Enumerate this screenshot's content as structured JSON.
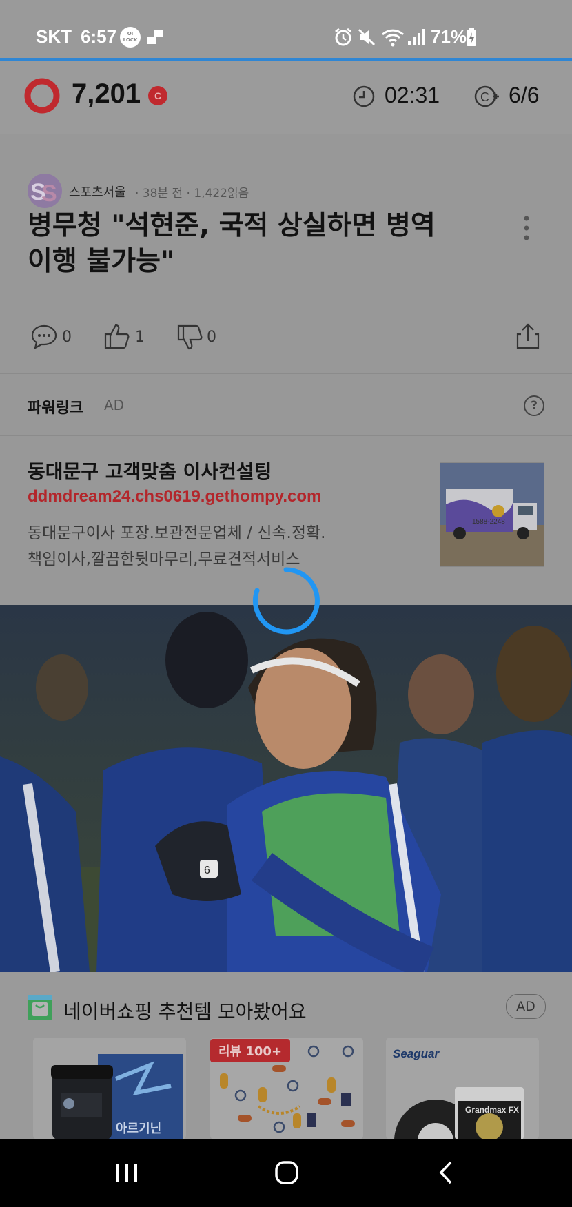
{
  "status_bar": {
    "carrier": "SKT",
    "time": "6:57",
    "lock_badge": "OI LOCK",
    "battery": "71%"
  },
  "header": {
    "points": "7,201",
    "coin_badge": "C",
    "timer": "02:31",
    "count": "6/6"
  },
  "article": {
    "source": "스포츠서울",
    "meta": "· 38분 전 · 1,422읽음",
    "title_line1": "병무청 \"석현준, 국적 상실하면 병역",
    "title_line2": "이행 불가능\"",
    "comments": "0",
    "likes": "1",
    "dislikes": "0"
  },
  "powerlink": {
    "label": "파워링크",
    "ad_tag": "AD",
    "help": "?"
  },
  "ad_item": {
    "title": "동대문구 고객맞춤 이사컨설팅",
    "url": "ddmdream24.chs0619.gethompy.com",
    "desc_line1": "동대문구이사 포장.보관전문업체 / 신속.정확.",
    "desc_line2": "책임이사,깔끔한뒷마무리,무료견적서비스",
    "truck_phone": "1588-2248"
  },
  "shopping": {
    "title": "네이버쇼핑 추천템 모아봤어요",
    "ad_tag": "AD",
    "card1_text": "아르기닌",
    "card2_badge": "리뷰 100+",
    "card3_brand": "Seaguar",
    "card3_product": "Grandmax FX"
  },
  "colors": {
    "accent_red": "#c0292e",
    "progress_blue": "#2f86d4",
    "spinner_blue": "#2196f3",
    "url_red": "#b3262b"
  }
}
